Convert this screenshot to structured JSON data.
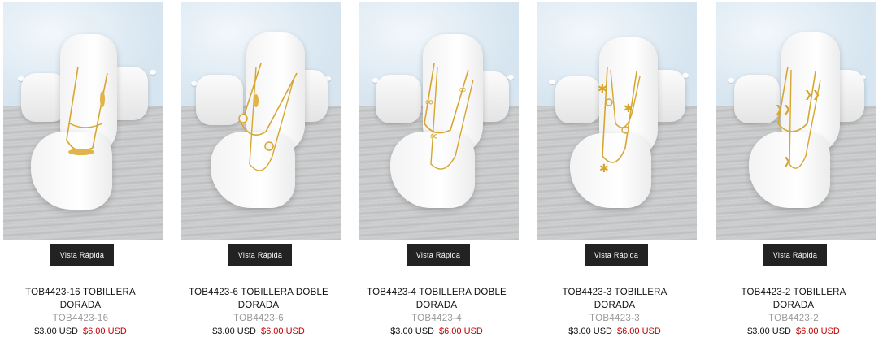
{
  "quick_view_label": "Vista Rápida",
  "products": [
    {
      "name": "TOB4423-16 TOBILLERA DORADA",
      "sku": "TOB4423-16",
      "price": "$3.00 USD",
      "old_price": "$6.00 USD",
      "charm": "leaf-bar"
    },
    {
      "name": "TOB4423-6 TOBILLERA DOBLE DORADA",
      "sku": "TOB4423-6",
      "price": "$3.00 USD",
      "old_price": "$6.00 USD",
      "charm": "crystal"
    },
    {
      "name": "TOB4423-4 TOBILLERA DOBLE DORADA",
      "sku": "TOB4423-4",
      "price": "$3.00 USD",
      "old_price": "$6.00 USD",
      "charm": "infinity"
    },
    {
      "name": "TOB4423-3 TOBILLERA DORADA",
      "sku": "TOB4423-3",
      "price": "$3.00 USD",
      "old_price": "$6.00 USD",
      "charm": "star"
    },
    {
      "name": "TOB4423-2 TOBILLERA DORADA",
      "sku": "TOB4423-2",
      "price": "$3.00 USD",
      "old_price": "$6.00 USD",
      "charm": "chevron"
    }
  ]
}
